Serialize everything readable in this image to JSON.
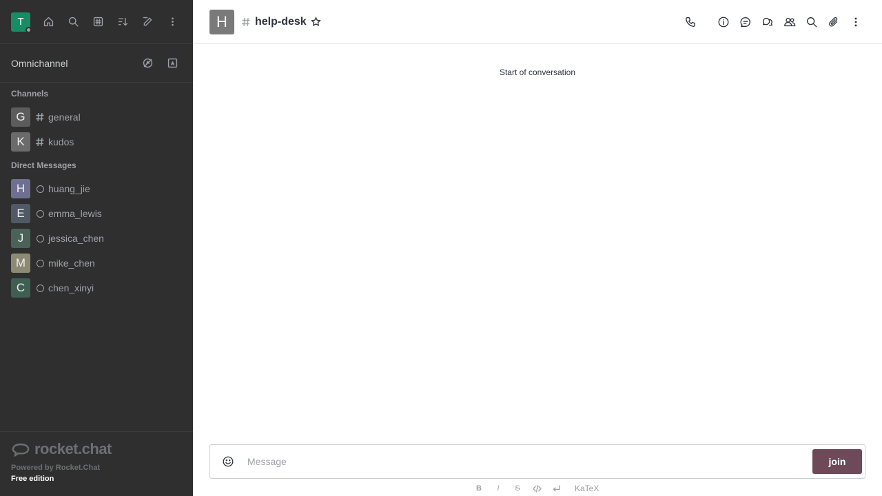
{
  "user": {
    "initial": "T"
  },
  "omnichannel": {
    "label": "Omnichannel"
  },
  "sidebar": {
    "channels_title": "Channels",
    "channels": [
      {
        "initial": "G",
        "name": "general",
        "color": "#5c5c5c"
      },
      {
        "initial": "K",
        "name": "kudos",
        "color": "#6b6b6b"
      }
    ],
    "dm_title": "Direct Messages",
    "dms": [
      {
        "initial": "H",
        "name": "huang_jie",
        "color": "#6f7091"
      },
      {
        "initial": "E",
        "name": "emma_lewis",
        "color": "#4f5a66"
      },
      {
        "initial": "J",
        "name": "jessica_chen",
        "color": "#4b6259"
      },
      {
        "initial": "M",
        "name": "mike_chen",
        "color": "#8c8a72"
      },
      {
        "initial": "C",
        "name": "chen_xinyi",
        "color": "#3f5f52"
      }
    ]
  },
  "footer": {
    "logo_text": "rocket.chat",
    "powered": "Powered by Rocket.Chat",
    "edition": "Free edition"
  },
  "header": {
    "room_initial": "H",
    "room_name": "help-desk"
  },
  "main": {
    "start_text": "Start of conversation"
  },
  "composer": {
    "placeholder": "Message",
    "join_label": "join"
  },
  "formatting": {
    "bold": "B",
    "italic": "I",
    "strike": "S",
    "katex": "KaTeX"
  }
}
